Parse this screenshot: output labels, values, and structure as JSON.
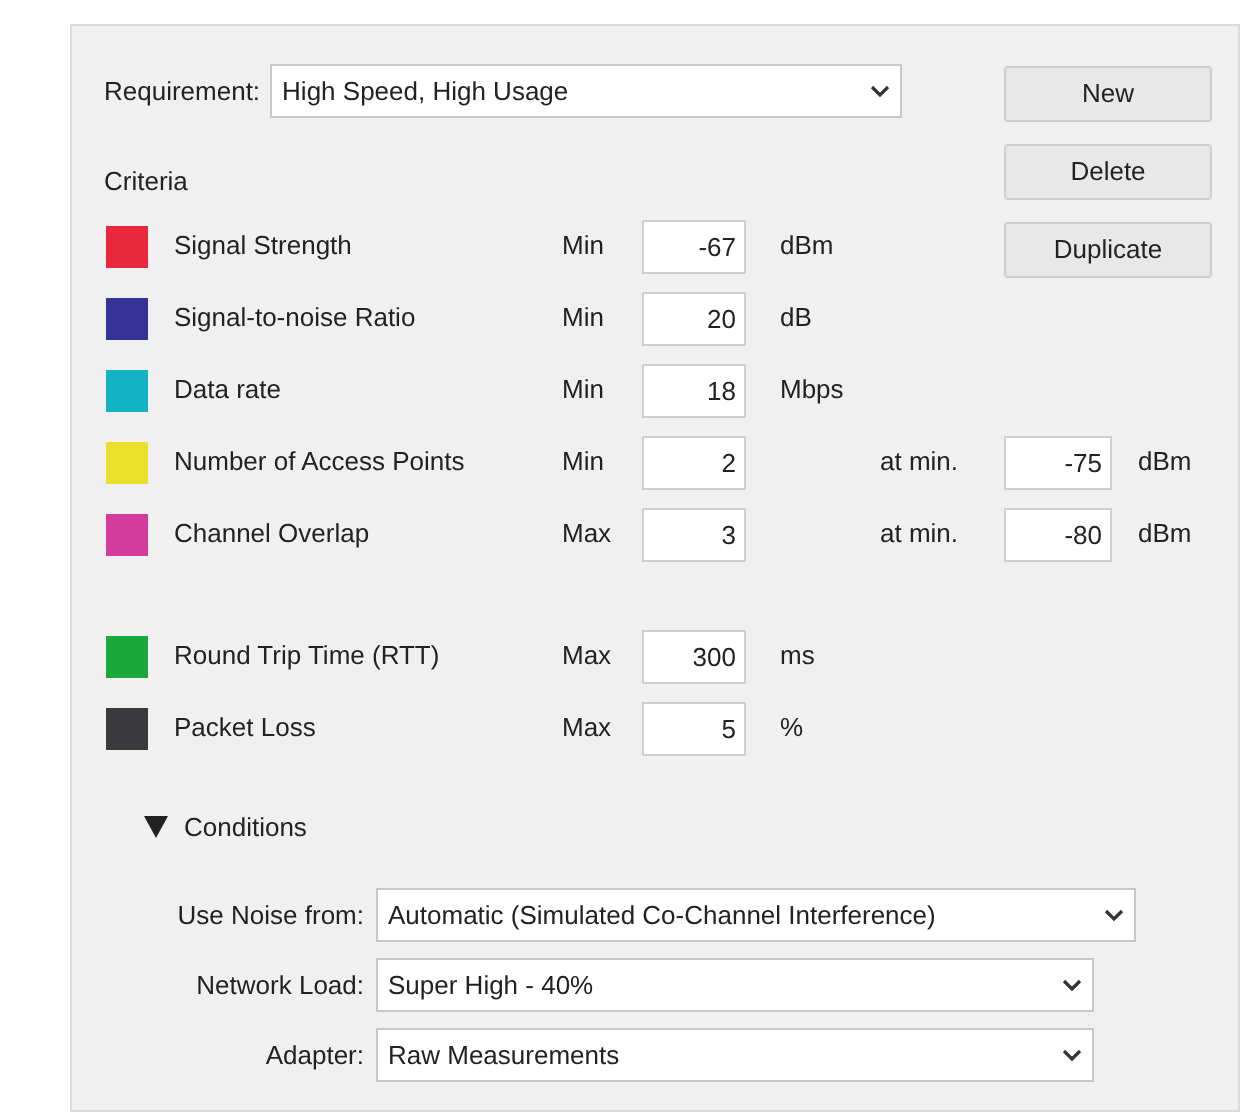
{
  "requirement": {
    "label": "Requirement:",
    "value": "High Speed, High Usage"
  },
  "buttons": [
    "New",
    "Delete",
    "Duplicate"
  ],
  "criteria_title": "Criteria",
  "criteria_groups": [
    [
      {
        "name": "Signal Strength",
        "color": "#e8283c",
        "bound": "Min",
        "value": "-67",
        "unit": "dBm"
      },
      {
        "name": "Signal-to-noise Ratio",
        "color": "#33339a",
        "bound": "Min",
        "value": "20",
        "unit": "dB"
      },
      {
        "name": "Data rate",
        "color": "#12b4c4",
        "bound": "Min",
        "value": "18",
        "unit": "Mbps"
      },
      {
        "name": "Number of Access Points",
        "color": "#e8e02c",
        "bound": "Min",
        "value": "2",
        "at_label": "at min.",
        "at_value": "-75",
        "at_unit": "dBm"
      },
      {
        "name": "Channel Overlap",
        "color": "#d43c9c",
        "bound": "Max",
        "value": "3",
        "at_label": "at min.",
        "at_value": "-80",
        "at_unit": "dBm"
      }
    ],
    [
      {
        "name": "Round Trip Time (RTT)",
        "color": "#1aa83c",
        "bound": "Max",
        "value": "300",
        "unit": "ms"
      },
      {
        "name": "Packet Loss",
        "color": "#3a3a3c",
        "bound": "Max",
        "value": "5",
        "unit": "%"
      }
    ]
  ],
  "conditions": {
    "label": "Conditions",
    "expanded": true,
    "fields": [
      {
        "label": "Use Noise from:",
        "value": "Automatic (Simulated Co-Channel Interference)"
      },
      {
        "label": "Network Load:",
        "value": "Super High - 40%"
      },
      {
        "label": "Adapter:",
        "value": "Raw Measurements"
      }
    ]
  }
}
